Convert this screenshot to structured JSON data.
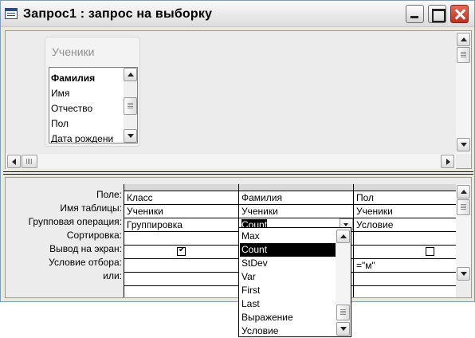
{
  "window": {
    "title": "Запрос1 : запрос на выборку"
  },
  "table_box": {
    "caption": "Ученики",
    "fields": [
      "Фамилия",
      "Имя",
      "Отчество",
      "Пол",
      "Дата рождени"
    ]
  },
  "row_labels": [
    "Поле:",
    "Имя таблицы:",
    "Групповая операция:",
    "Сортировка:",
    "Вывод на экран:",
    "Условие отбора:",
    "или:"
  ],
  "columns": [
    {
      "field": "Класс",
      "table": "Ученики",
      "group": "Группировка",
      "show": true,
      "criteria": ""
    },
    {
      "field": "Фамилия",
      "table": "Ученики",
      "group": "Count",
      "show": true,
      "criteria": ""
    },
    {
      "field": "Пол",
      "table": "Ученики",
      "group": "Условие",
      "show": false,
      "criteria": "=\"м\""
    }
  ],
  "dropdown": {
    "items": [
      "Max",
      "Count",
      "StDev",
      "Var",
      "First",
      "Last",
      "Выражение",
      "Условие"
    ],
    "selected": "Count"
  }
}
